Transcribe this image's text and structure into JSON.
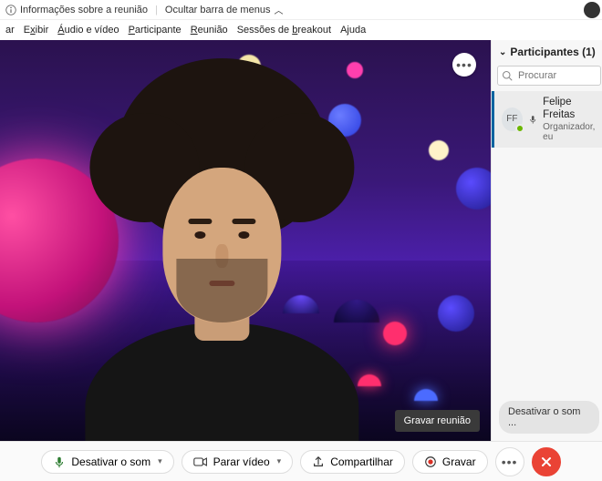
{
  "topbar": {
    "info_label": "Informações sobre a reunião",
    "hide_menu_label": "Ocultar barra de menus"
  },
  "menubar": {
    "items": [
      "ar",
      "Exibir",
      "Áudio e vídeo",
      "Participante",
      "Reunião",
      "Sessões de breakout",
      "Ajuda"
    ],
    "underline_idx": [
      null,
      0,
      0,
      0,
      0,
      11,
      1
    ]
  },
  "video": {
    "tooltip": "Gravar reunião"
  },
  "participants": {
    "title_prefix": "Participantes",
    "count": 1,
    "search_placeholder": "Procurar",
    "list": [
      {
        "initials": "FF",
        "name": "Felipe Freitas",
        "role": "Organizador, eu"
      }
    ],
    "bottom_hint": "Desativar o som ..."
  },
  "controls": {
    "mute": "Desativar o som",
    "video": "Parar vídeo",
    "share": "Compartilhar",
    "record": "Gravar"
  }
}
